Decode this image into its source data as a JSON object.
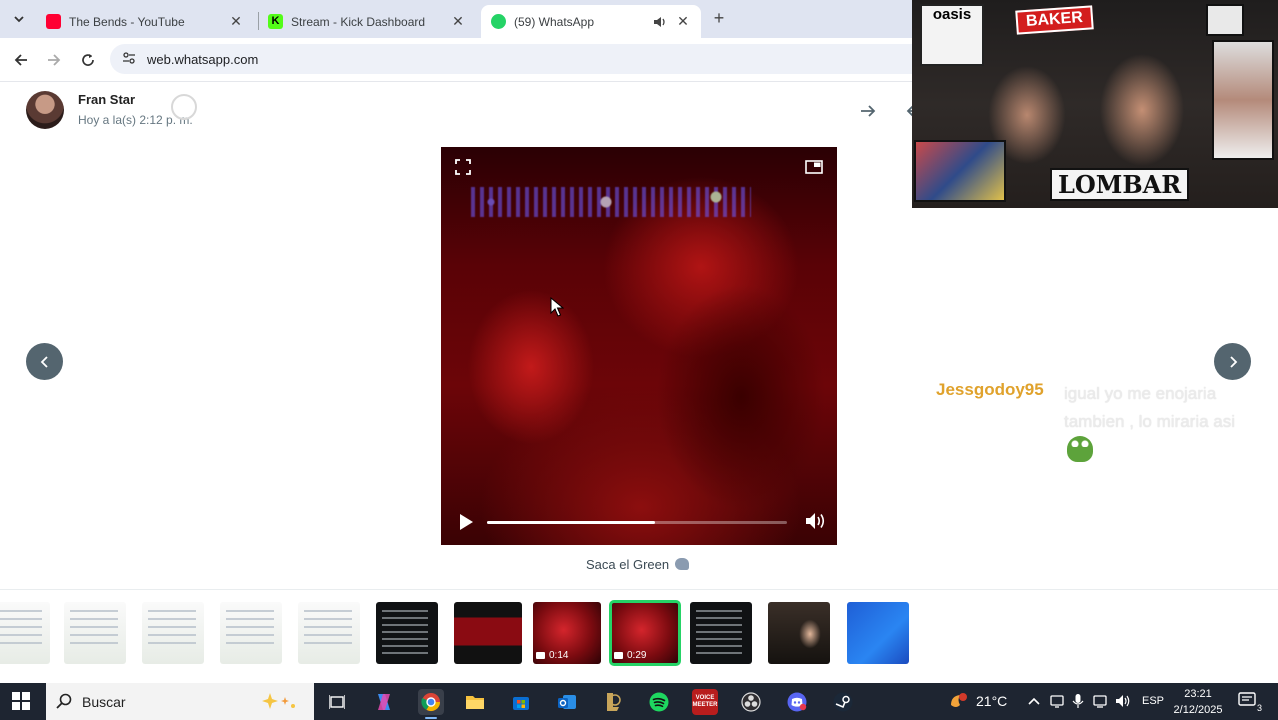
{
  "browser": {
    "tabs": [
      {
        "title": "The Bends - YouTube",
        "favicon": "youtube-icon",
        "favicon_color": "#ff0033"
      },
      {
        "title": "Stream - Kick Dashboard",
        "favicon": "kick-icon",
        "favicon_color": "#53fc18"
      },
      {
        "title": "(59) WhatsApp",
        "favicon": "whatsapp-icon",
        "favicon_color": "#25d366",
        "active": true,
        "audio": "speaker-icon"
      }
    ],
    "url": "web.whatsapp.com"
  },
  "viewer": {
    "sender_name": "Fran Star",
    "timestamp": "Hoy a la(s) 2:12 p. m.",
    "caption": "Saca el Green",
    "progress": 0.56,
    "accent_color": "#25d366"
  },
  "stream_overlay": {
    "stickers": [
      "oasis",
      "BAKER",
      "LOMBAR"
    ],
    "chat": {
      "username": "Jessgodoy95",
      "message": "igual yo me enojaria tambien , lo miraria asi",
      "username_color": "#e0a22c"
    }
  },
  "thumbnails": [
    {
      "kind": "light"
    },
    {
      "kind": "light"
    },
    {
      "kind": "light"
    },
    {
      "kind": "light"
    },
    {
      "kind": "light"
    },
    {
      "kind": "dark"
    },
    {
      "kind": "darkred"
    },
    {
      "kind": "red",
      "duration": "0:14"
    },
    {
      "kind": "red",
      "duration": "0:29",
      "active": true
    },
    {
      "kind": "dark"
    },
    {
      "kind": "people"
    },
    {
      "kind": "blue"
    }
  ],
  "taskbar": {
    "search_placeholder": "Buscar",
    "temperature": "21°C",
    "language": "ESP",
    "time": "23:21",
    "date": "2/12/2025",
    "notification_count": "3",
    "voicemeeter_label_1": "VOICE",
    "voicemeeter_label_2": "MEETER"
  }
}
